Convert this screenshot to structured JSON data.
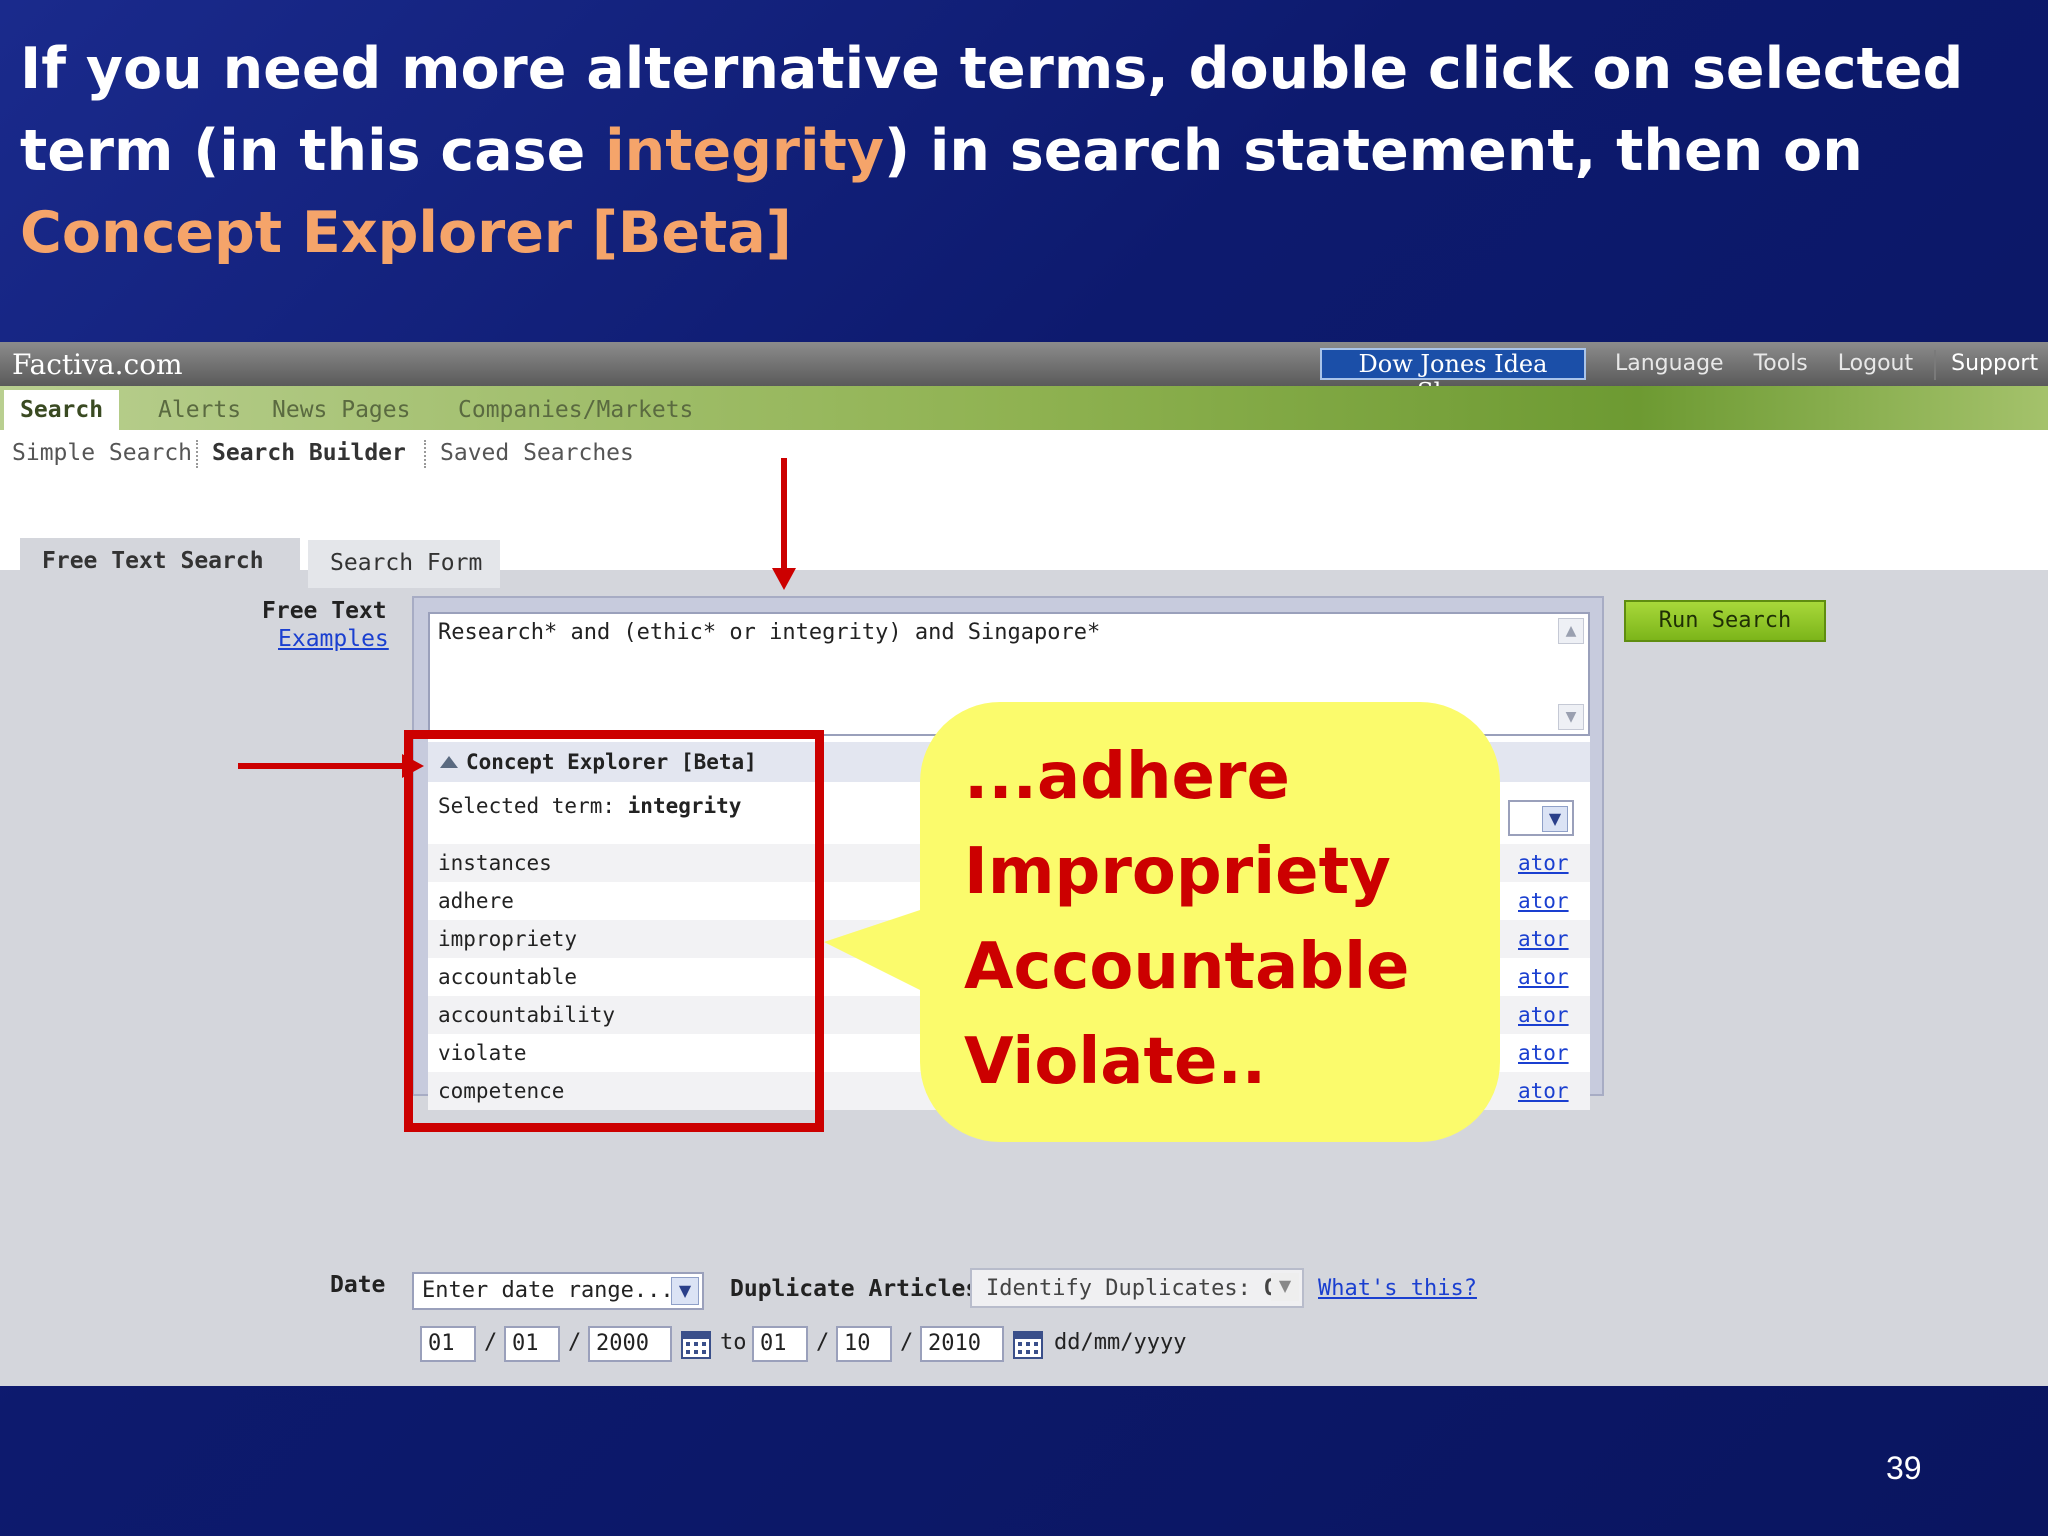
{
  "slide": {
    "title_part1": "If you need more alternative terms, double click on selected term (in this case ",
    "title_hl1": "integrity",
    "title_part2": ") in search statement, then on ",
    "title_hl2": "Concept Explorer [Beta]",
    "page_number": "39"
  },
  "app": {
    "logo": "Factiva.com",
    "idea_share": "Dow Jones Idea Share",
    "top_links": [
      "Language",
      "Tools",
      "Logout",
      "Support"
    ]
  },
  "nav": {
    "tabs": [
      "Search",
      "Alerts",
      "News Pages",
      "Companies/Markets"
    ],
    "subnav": [
      "Simple Search",
      "Search Builder",
      "Saved Searches"
    ]
  },
  "search_tabs": [
    "Free Text Search",
    "Search Form"
  ],
  "free_text": {
    "label": "Free Text",
    "examples_link": "Examples",
    "query": "Research* and (ethic* or integrity) and Singapore*"
  },
  "concept_explorer": {
    "header": "Concept Explorer [Beta]",
    "selected_prefix": "Selected term: ",
    "selected_term": "integrity",
    "terms": [
      "instances",
      "adhere",
      "impropriety",
      "accountable",
      "accountability",
      "violate",
      "competence"
    ],
    "operator_link": "ator"
  },
  "callout": {
    "lines": [
      "...adhere",
      "Impropriety",
      "Accountable",
      "Violate.."
    ],
    "bg_color": "#fbfb6c",
    "text_color": "#cc0000"
  },
  "run_search": "Run Search",
  "date": {
    "label": "Date",
    "range_placeholder": "Enter date range...",
    "from": {
      "day": "01",
      "month": "01",
      "year": "2000"
    },
    "to": {
      "day": "01",
      "month": "10",
      "year": "2010"
    },
    "to_label": "to",
    "separator": "/",
    "format": "dd/mm/yyyy"
  },
  "duplicates": {
    "label": "Duplicate Articles",
    "value_prefix": "Identify Duplicates: ",
    "value": "On",
    "help_link": "What's this?"
  },
  "colors": {
    "accent_red": "#cc0000",
    "title_highlight": "#f5a46a",
    "link_blue": "#1a3fd0",
    "run_button_green": "#8ec726"
  }
}
